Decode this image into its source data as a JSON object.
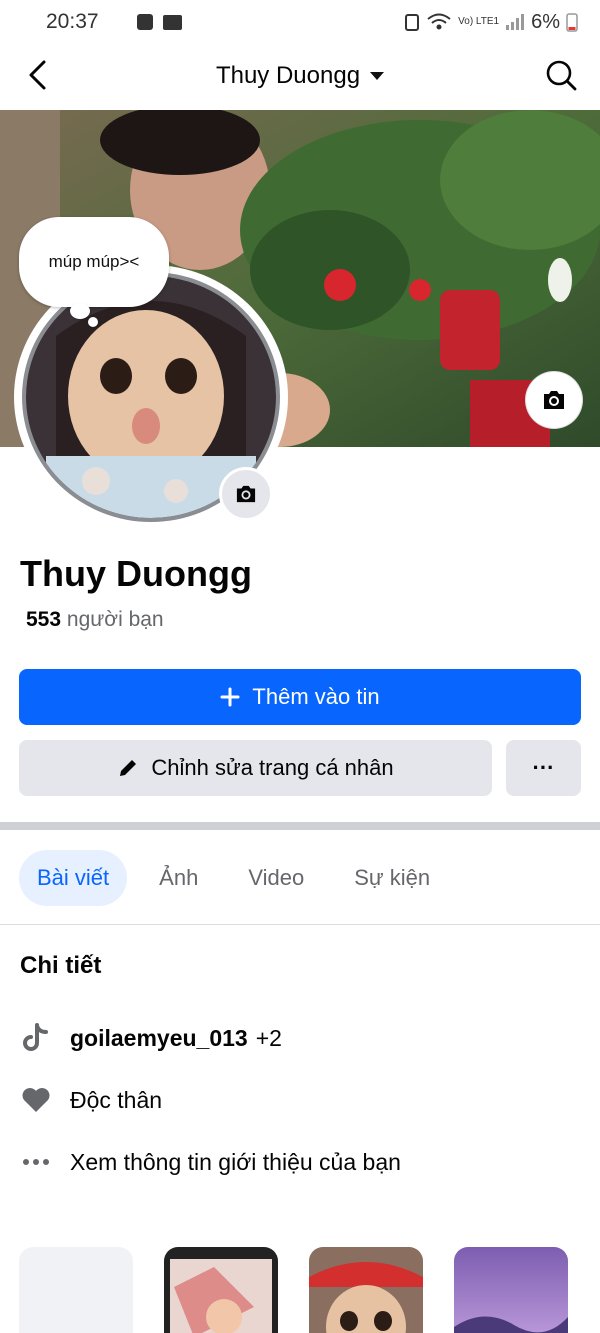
{
  "status_bar": {
    "time": "20:37",
    "network": "Vo) LTE1",
    "battery": "6%"
  },
  "top_bar": {
    "title": "Thuy Duongg"
  },
  "note_bubble": {
    "text": "múp múp><"
  },
  "profile": {
    "name": "Thuy Duongg",
    "friend_count": "553",
    "friend_label": "người bạn"
  },
  "actions": {
    "add_story_label": "Thêm vào tin",
    "edit_profile_label": "Chỉnh sửa trang cá nhân",
    "more_label": "···"
  },
  "tabs": [
    {
      "label": "Bài viết",
      "active": true
    },
    {
      "label": "Ảnh",
      "active": false
    },
    {
      "label": "Video",
      "active": false
    },
    {
      "label": "Sự kiện",
      "active": false
    }
  ],
  "details": {
    "title": "Chi tiết",
    "tiktok_handle": "goilaemyeu_013",
    "tiktok_extra": "+2",
    "relationship": "Độc thân",
    "see_intro": "Xem thông tin giới thiệu của bạn"
  },
  "colors": {
    "primary": "#0866ff",
    "secondary_button": "#e4e6eb",
    "active_tab_bg": "#e7f0ff",
    "muted_text": "#65676b"
  },
  "icons": [
    "back-arrow-icon",
    "search-icon",
    "camera-icon",
    "plus-icon",
    "pencil-icon",
    "tiktok-icon",
    "heart-icon",
    "more-dots-icon"
  ]
}
